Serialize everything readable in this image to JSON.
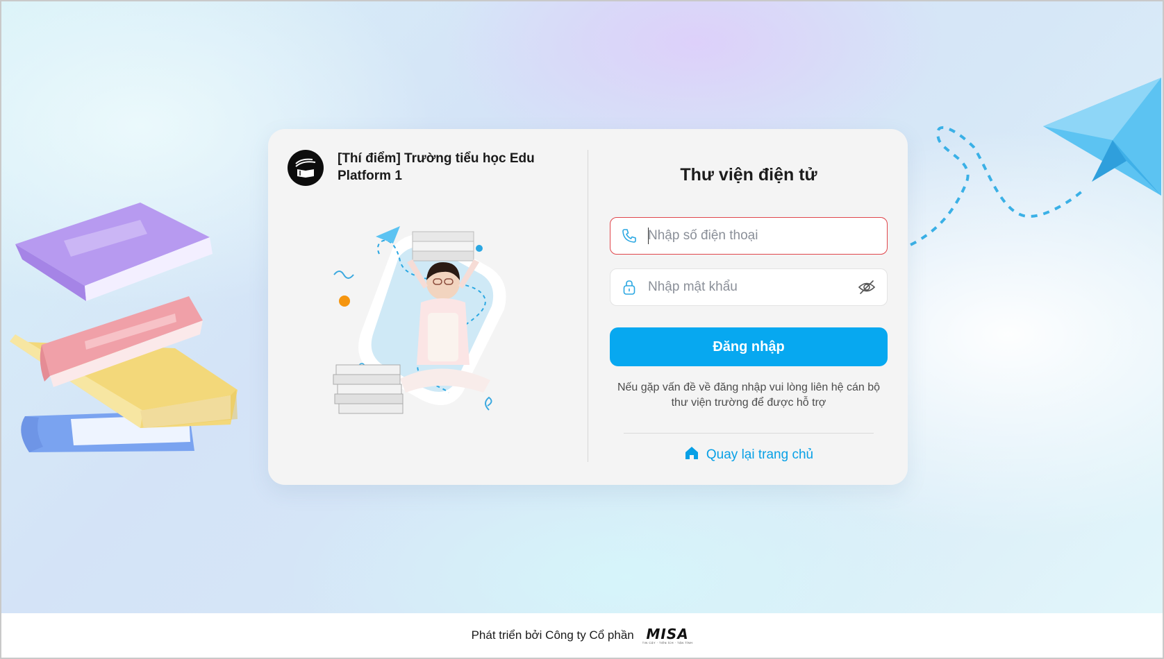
{
  "school": {
    "name": "[Thí điểm] Trường tiểu học Edu Platform 1",
    "logo_icon": "book-logo-icon"
  },
  "login": {
    "title": "Thư viện điện tử",
    "phone_placeholder": "Nhập số điện thoại",
    "phone_icon": "phone-icon",
    "password_placeholder": "Nhập mật khẩu",
    "password_icon": "lock-icon",
    "toggle_icon": "eye-off-icon",
    "submit_label": "Đăng nhập",
    "help_text": "Nếu gặp vấn đề về đăng nhập vui lòng liên hệ cán bộ thư viện trường để được hỗ trợ",
    "back_home_label": "Quay lại trang chủ",
    "back_home_icon": "home-icon"
  },
  "footer": {
    "text": "Phát triển bởi Công ty Cổ phần",
    "brand": "MISA",
    "brand_tagline": "TIN CẬY · TIỆN ÍCH · TẬN TÌNH"
  },
  "colors": {
    "accent": "#07a8f0",
    "error_border": "#e0454b",
    "card_bg": "#f4f4f4"
  }
}
